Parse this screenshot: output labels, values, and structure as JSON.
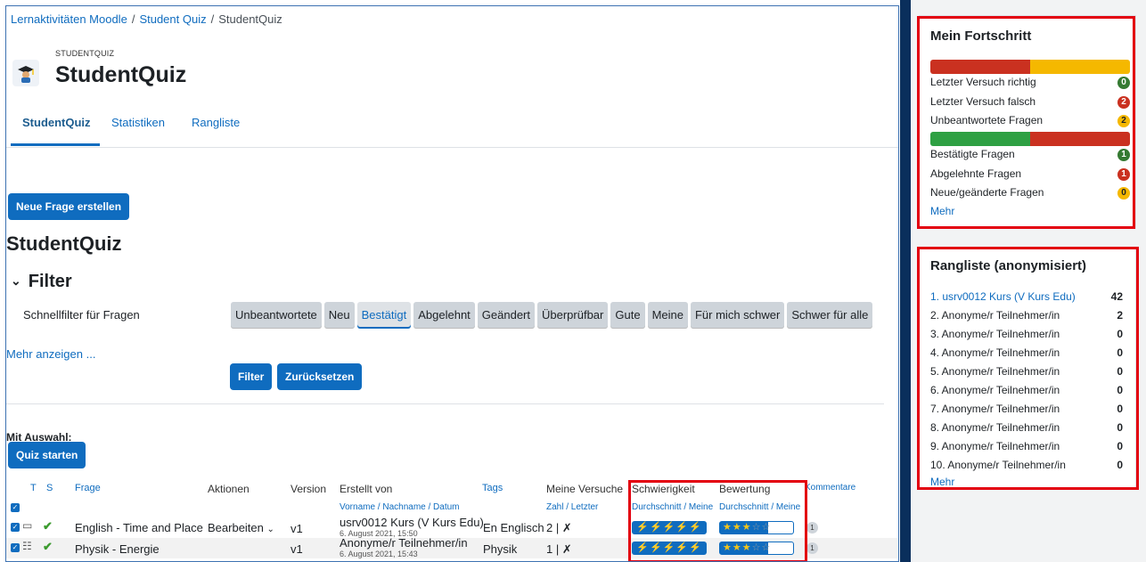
{
  "breadcrumb": {
    "items": [
      "Lernaktivitäten Moodle",
      "Student Quiz"
    ],
    "current": "StudentQuiz",
    "sep": "/"
  },
  "header": {
    "overline": "STUDENTQUIZ",
    "title": "StudentQuiz"
  },
  "tabs": [
    "StudentQuiz",
    "Statistiken",
    "Rangliste"
  ],
  "actions": {
    "new_question": "Neue Frage erstellen",
    "filter": "Filter",
    "reset": "Zurücksetzen",
    "with_selection": "Mit Auswahl:",
    "start_quiz": "Quiz starten"
  },
  "section": {
    "title": "StudentQuiz",
    "filter_title": "Filter",
    "quickfilter_label": "Schnellfilter für Fragen",
    "show_more": "Mehr anzeigen ..."
  },
  "quickfilters": [
    "Unbeantwortete",
    "Neu",
    "Bestätigt",
    "Abgelehnt",
    "Geändert",
    "Überprüfbar",
    "Gute",
    "Meine",
    "Für mich schwer",
    "Schwer für alle"
  ],
  "table": {
    "headers": {
      "t": "T",
      "s": "S",
      "frage": "Frage",
      "aktionen": "Aktionen",
      "version": "Version",
      "erstellt": "Erstellt von",
      "tags": "Tags",
      "versuche": "Meine Versuche",
      "schwierigkeit": "Schwierigkeit",
      "bewertung": "Bewertung",
      "kommentare": "Kommentare"
    },
    "subheaders": {
      "erstellt": "Vorname / Nachname / Datum",
      "versuche": "Zahl / Letzter",
      "schwierigkeit": "Durchschnitt / Meine",
      "bewertung": "Durchschnitt / Meine"
    },
    "rows": [
      {
        "question": "English - Time and Place",
        "action": "Bearbeiten",
        "version": "v1",
        "author": "usrv0012 Kurs (V Kurs Edu)",
        "date": "6. August 2021, 15:50",
        "tag": "En Englisch",
        "attempts": "2 | ✗",
        "comments": "1",
        "difficulty": "⚡⚡⚡⚡⚡",
        "rating_full": "★★★",
        "rating_empty": "☆☆"
      },
      {
        "question": "Physik - Energie",
        "action": "",
        "version": "v1",
        "author": "Anonyme/r Teilnehmer/in",
        "date": "6. August 2021, 15:43",
        "tag": "Physik",
        "attempts": "1 | ✗",
        "comments": "1",
        "difficulty": "⚡⚡⚡⚡⚡",
        "rating_full": "★★★",
        "rating_empty": "☆☆"
      }
    ]
  },
  "progress": {
    "title": "Mein Fortschritt",
    "bar1": [
      0.5,
      0.5
    ],
    "bar2": [
      0.5,
      0.5
    ],
    "items1": [
      {
        "label": "Letzter Versuch richtig",
        "count": "0",
        "color": "#357a32"
      },
      {
        "label": "Letzter Versuch falsch",
        "count": "2",
        "color": "#ca3120"
      },
      {
        "label": "Unbeantwortete Fragen",
        "count": "2",
        "color": "#f0ad4e"
      }
    ],
    "items2": [
      {
        "label": "Bestätigte Fragen",
        "count": "1",
        "color": "#357a32"
      },
      {
        "label": "Abgelehnte Fragen",
        "count": "1",
        "color": "#ca3120"
      },
      {
        "label": "Neue/geänderte Fragen",
        "count": "0",
        "color": "#f0ad4e"
      }
    ],
    "more": "Mehr"
  },
  "ranking": {
    "title": "Rangliste (anonymisiert)",
    "entries": [
      {
        "name": "1. usrv0012 Kurs (V Kurs Edu)",
        "score": "42"
      },
      {
        "name": "2. Anonyme/r Teilnehmer/in",
        "score": "2"
      },
      {
        "name": "3. Anonyme/r Teilnehmer/in",
        "score": "0"
      },
      {
        "name": "4. Anonyme/r Teilnehmer/in",
        "score": "0"
      },
      {
        "name": "5. Anonyme/r Teilnehmer/in",
        "score": "0"
      },
      {
        "name": "6. Anonyme/r Teilnehmer/in",
        "score": "0"
      },
      {
        "name": "7. Anonyme/r Teilnehmer/in",
        "score": "0"
      },
      {
        "name": "8. Anonyme/r Teilnehmer/in",
        "score": "0"
      },
      {
        "name": "9. Anonyme/r Teilnehmer/in",
        "score": "0"
      },
      {
        "name": "10. Anonyme/r Teilnehmer/in",
        "score": "0"
      }
    ],
    "more": "Mehr"
  },
  "colors": {
    "primary": "#0f6cbf",
    "highlight": "#e3000f",
    "success": "#357a32",
    "danger": "#ca3120",
    "warning": "#f0ad4e"
  }
}
